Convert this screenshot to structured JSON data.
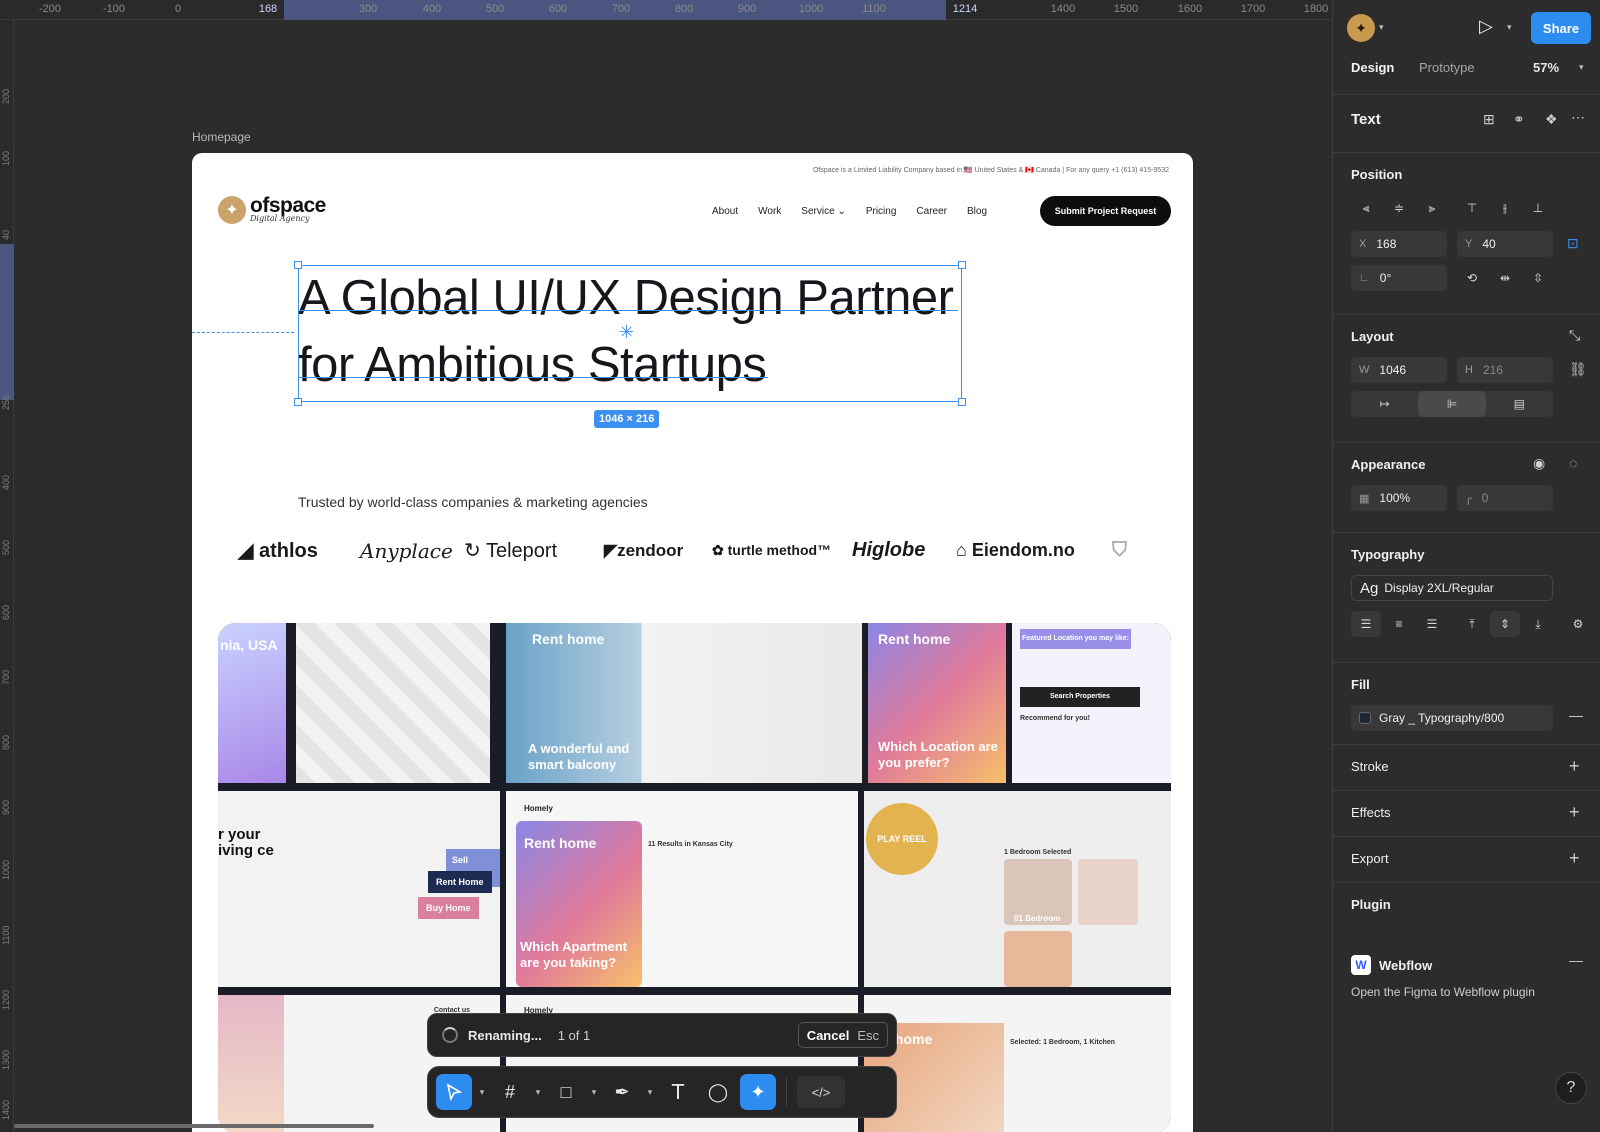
{
  "rulers": {
    "top": [
      "-200",
      "-100",
      "0",
      "168",
      "300",
      "400",
      "500",
      "600",
      "700",
      "800",
      "900",
      "1000",
      "1100",
      "1214",
      "1400",
      "1500",
      "1600",
      "1700",
      "1800"
    ],
    "left": [
      "200",
      "100",
      "40",
      "256",
      "400",
      "500",
      "600",
      "700",
      "800",
      "900",
      "1000",
      "1100",
      "1200",
      "1300",
      "1400"
    ]
  },
  "canvas": {
    "frame_label": "Homepage",
    "dimension_badge": "1046 × 216"
  },
  "site": {
    "top_note": "Ofspace is a Limited Liability Company based in 🇺🇸 United States & 🇨🇦 Canada   |   For any query +1 (613) 415-9532",
    "logo_name": "ofspace",
    "logo_tagline": "Digital Agency",
    "nav": [
      "About",
      "Work",
      "Service",
      "Pricing",
      "Career",
      "Blog"
    ],
    "cta": "Submit Project Request",
    "hero_line1": "A Global UI/UX Design Partner",
    "hero_line2": "for Ambitious Startups",
    "trusted": "Trusted by world-class companies & marketing agencies",
    "brands": [
      "athlos",
      "Anyplace",
      "Teleport",
      "zendoor",
      "turtle method™",
      "Higlobe",
      "Eiendom.no"
    ],
    "gallery": {
      "t1": "nia, USA",
      "t2": "Rent home",
      "t2b": "A wonderful and smart balcony",
      "t3": "Rent home",
      "t3b": "Which Location are you prefer?",
      "t4": "Featured Location you may like:",
      "t4b": "Search Properties",
      "t4c": "Recommend for you!",
      "t5": "r your iving ce",
      "t5b": "Sell Home",
      "t5c": "Rent Home",
      "t5d": "Buy Home",
      "t6": "Homely",
      "t6b": "Rent home",
      "t6c": "Which Apartment are you taking?",
      "t6d": "11 Results in Kansas City",
      "play": "PLAY REEL",
      "t7": "1 Bedroom Selected",
      "t7b": "01 Bedroom",
      "t8": "Homely",
      "t8b": "ent home",
      "t8c": "Selected: 1 Bedroom, 1 Kitchen",
      "contact": "Contact us"
    }
  },
  "rename": {
    "label": "Renaming...",
    "count": "1 of 1",
    "cancel": "Cancel",
    "shortcut": "Esc"
  },
  "toolbar": {
    "move": "move-tool",
    "frame": "frame-tool",
    "shape": "rectangle-tool",
    "pen": "pen-tool",
    "text": "T",
    "comment": "comment-tool",
    "ai": "ai-tool",
    "code": "</>"
  },
  "panel": {
    "share": "Share",
    "tabs": [
      "Design",
      "Prototype"
    ],
    "zoom": "57%",
    "layer_type": "Text",
    "position": {
      "title": "Position",
      "x_label": "X",
      "x": "168",
      "y_label": "Y",
      "y": "40",
      "rotation": "0°"
    },
    "layout": {
      "title": "Layout",
      "w_label": "W",
      "w": "1046",
      "h_label": "H",
      "h": "216"
    },
    "appearance": {
      "title": "Appearance",
      "opacity": "100%",
      "radius": "0"
    },
    "typography": {
      "title": "Typography",
      "style_prefix": "Ag",
      "style": "Display 2XL/Regular"
    },
    "fill": {
      "title": "Fill",
      "name": "Gray _ Typography/800",
      "swatch": "#1f2735"
    },
    "stroke": "Stroke",
    "effects": "Effects",
    "export": "Export",
    "plugin": {
      "title": "Plugin",
      "name": "Webflow",
      "desc": "Open the Figma to Webflow plugin"
    },
    "help": "?"
  },
  "colors": {
    "accent": "#2d8cf0",
    "selection": "#3b8fee",
    "panel_bg": "#2c2c2c"
  }
}
